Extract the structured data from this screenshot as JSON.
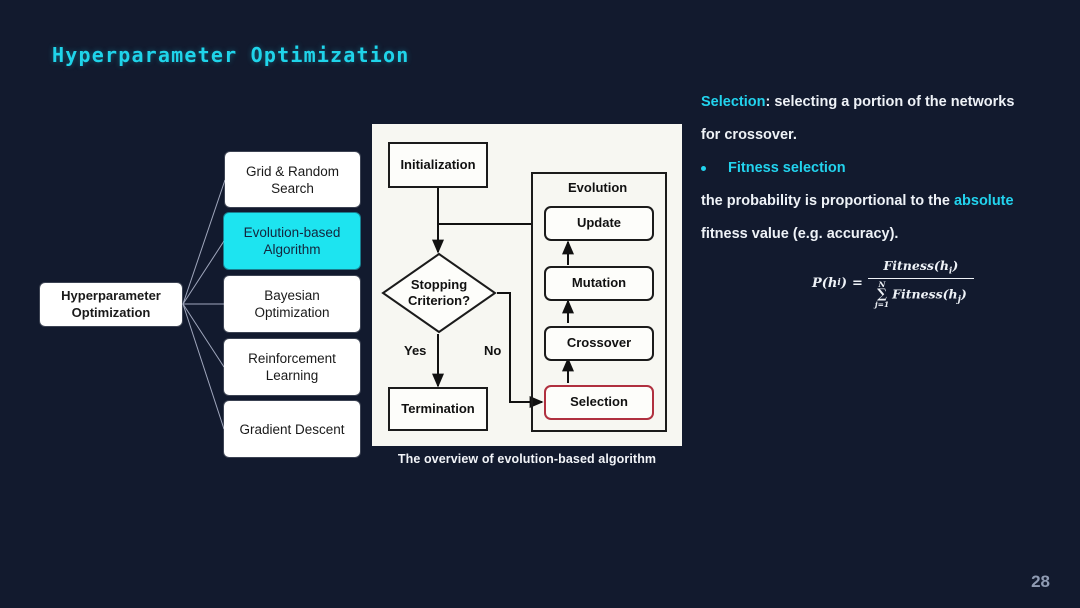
{
  "slide": {
    "title": "Hyperparameter Optimization",
    "page_number": "28",
    "background_color": "#121a2e",
    "accent_color": "#22d3ee"
  },
  "mindmap": {
    "root": {
      "label": "Hyperparameter\nOptimization"
    },
    "children": [
      {
        "label": "Grid & Random\nSearch",
        "highlighted": false
      },
      {
        "label": "Evolution-based\nAlgorithm",
        "highlighted": true,
        "highlight_color": "#1de4f0"
      },
      {
        "label": "Bayesian\nOptimization",
        "highlighted": false
      },
      {
        "label": "Reinforcement\nLearning",
        "highlighted": false
      },
      {
        "label": "Gradient Descent",
        "highlighted": false
      }
    ]
  },
  "flowchart": {
    "caption": "The overview of evolution-based algorithm",
    "nodes": {
      "initialization": "Initialization",
      "stopping": "Stopping\nCriterion?",
      "termination": "Termination",
      "group_label": "Evolution",
      "update": "Update",
      "mutation": "Mutation",
      "crossover": "Crossover",
      "selection": "Selection"
    },
    "edge_labels": {
      "yes": "Yes",
      "no": "No"
    },
    "selection_highlight_color": "#b0303f"
  },
  "notes": {
    "line1_key": "Selection",
    "line1_rest": ": selecting a portion of the networks",
    "line2": "for crossover.",
    "bullet1": "Fitness selection",
    "line3_a": "the probability is proportional to the ",
    "line3_key": "absolute",
    "line4": "fitness value (e.g. accuracy)."
  },
  "formula": {
    "lhs": "P(h",
    "lhs_sub": "i",
    "lhs_close": ")",
    "equals": "=",
    "numerator": "Fitness(h",
    "numerator_sub": "i",
    "numerator_close": ")",
    "sum_upper": "N",
    "sum_symbol": "∑",
    "sum_lower": "j=1",
    "denominator": "Fitness(h",
    "denominator_sub": "j",
    "denominator_close": ")"
  }
}
